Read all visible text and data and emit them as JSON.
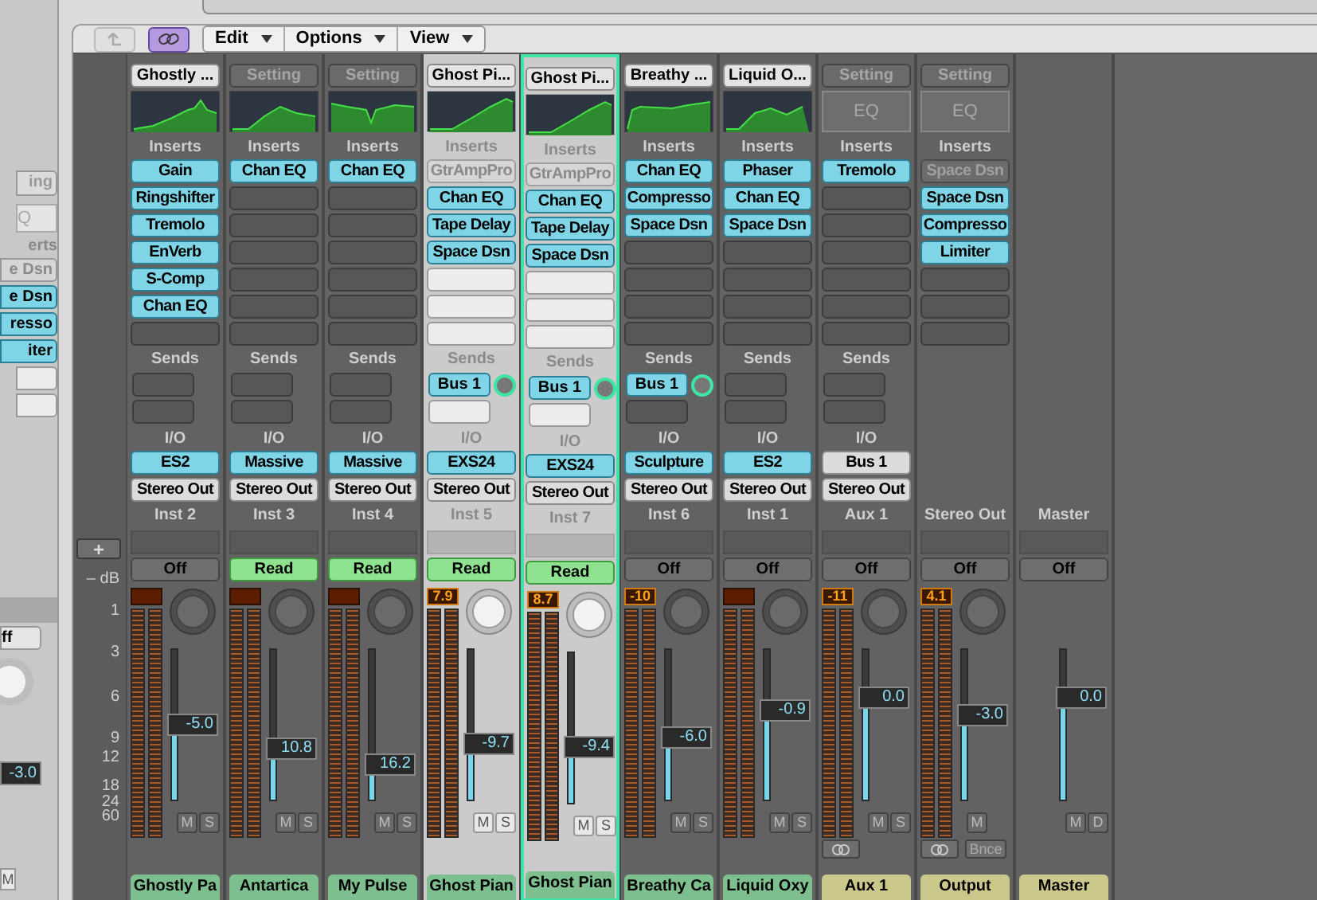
{
  "side_panel": {
    "upper": [
      {
        "kind": "button",
        "text": "ing"
      },
      {
        "kind": "field",
        "text": "Q"
      },
      {
        "kind": "label",
        "text": "erts"
      },
      {
        "kind": "slot",
        "text": "e Dsn",
        "bypassed": true
      },
      {
        "kind": "slot",
        "text": "e Dsn",
        "bypassed": false
      },
      {
        "kind": "slot",
        "text": "resso",
        "bypassed": false
      },
      {
        "kind": "slot",
        "text": "iter",
        "bypassed": false
      },
      {
        "kind": "empty"
      },
      {
        "kind": "empty"
      }
    ],
    "automation": "ff",
    "fader_value": "-3.0",
    "mute": "M"
  },
  "toolbar": {
    "back": {
      "disabled": true
    },
    "link": {
      "on": true
    },
    "menus": [
      "Edit",
      "Options",
      "View"
    ]
  },
  "scale": {
    "add": "+",
    "marks": [
      "– dB",
      "1",
      "3",
      "6",
      "9",
      "12",
      "18",
      "24",
      "60"
    ]
  },
  "strips": [
    {
      "kind": "track",
      "selected": false,
      "highlighted": false,
      "setting": {
        "text": "Ghostly ...",
        "dim": false
      },
      "eq": {
        "kind": "curve"
      },
      "inserts_label": "Inserts",
      "inserts": [
        {
          "text": "Gain",
          "bypassed": false
        },
        {
          "text": "Ringshifter",
          "bypassed": false
        },
        {
          "text": "Tremolo",
          "bypassed": false
        },
        {
          "text": "EnVerb",
          "bypassed": false
        },
        {
          "text": "S-Comp",
          "bypassed": false
        },
        {
          "text": "Chan EQ",
          "bypassed": false
        }
      ],
      "sends_label": "Sends",
      "io_label": "I/O",
      "input": {
        "text": "ES2",
        "active": true
      },
      "output": {
        "text": "Stereo Out",
        "active": false
      },
      "channel": "Inst 2",
      "automation": {
        "text": "Off",
        "read": false
      },
      "level": 0.5,
      "fader_value": "-5.0",
      "buttons": [
        "M",
        "S"
      ],
      "name": "Ghostly Pa",
      "color": "#7dbf8e"
    },
    {
      "kind": "track",
      "selected": false,
      "highlighted": false,
      "setting": {
        "text": "Setting",
        "dim": true
      },
      "eq": {
        "kind": "curve"
      },
      "inserts_label": "Inserts",
      "inserts": [
        {
          "text": "Chan EQ",
          "bypassed": false
        }
      ],
      "sends_label": "Sends",
      "io_label": "I/O",
      "input": {
        "text": "Massive",
        "active": true
      },
      "output": {
        "text": "Stereo Out",
        "active": false
      },
      "channel": "Inst 3",
      "automation": {
        "text": "Read",
        "read": true
      },
      "level": 0.34,
      "fader_value": "10.8",
      "buttons": [
        "M",
        "S"
      ],
      "name": "Antartica",
      "color": "#7dbf8e"
    },
    {
      "kind": "track",
      "selected": false,
      "highlighted": false,
      "setting": {
        "text": "Setting",
        "dim": true
      },
      "eq": {
        "kind": "curve"
      },
      "inserts_label": "Inserts",
      "inserts": [
        {
          "text": "Chan EQ",
          "bypassed": false
        }
      ],
      "sends_label": "Sends",
      "io_label": "I/O",
      "input": {
        "text": "Massive",
        "active": true
      },
      "output": {
        "text": "Stereo Out",
        "active": false
      },
      "channel": "Inst 4",
      "automation": {
        "text": "Read",
        "read": true
      },
      "level": 0.23,
      "fader_value": "16.2",
      "buttons": [
        "M",
        "S"
      ],
      "name": "My Pulse",
      "color": "#7dbf8e"
    },
    {
      "kind": "track",
      "selected": false,
      "highlighted": true,
      "setting": {
        "text": "Ghost Pi...",
        "dim": false
      },
      "eq": {
        "kind": "curve"
      },
      "inserts_label": "Inserts",
      "inserts": [
        {
          "text": "GtrAmpPro",
          "bypassed": true
        },
        {
          "text": "Chan EQ",
          "bypassed": false
        },
        {
          "text": "Tape Delay",
          "bypassed": false
        },
        {
          "text": "Space Dsn",
          "bypassed": false
        }
      ],
      "sends_label": "Sends",
      "sends": [
        {
          "text": "Bus 1"
        }
      ],
      "io_label": "I/O",
      "input": {
        "text": "EXS24",
        "active": true
      },
      "output": {
        "text": "Stereo Out",
        "active": false
      },
      "channel": "Inst 5",
      "automation": {
        "text": "Read",
        "read": true
      },
      "peak": "7.9",
      "level": 0.37,
      "fader_value": "-9.7",
      "buttons": [
        "M",
        "S"
      ],
      "name": "Ghost Pian",
      "color": "#7dbf8e"
    },
    {
      "kind": "track",
      "selected": true,
      "highlighted": true,
      "setting": {
        "text": "Ghost Pi...",
        "dim": false
      },
      "eq": {
        "kind": "curve"
      },
      "inserts_label": "Inserts",
      "inserts": [
        {
          "text": "GtrAmpPro",
          "bypassed": true
        },
        {
          "text": "Chan EQ",
          "bypassed": false
        },
        {
          "text": "Tape Delay",
          "bypassed": false
        },
        {
          "text": "Space Dsn",
          "bypassed": false
        }
      ],
      "sends_label": "Sends",
      "sends": [
        {
          "text": "Bus 1"
        }
      ],
      "io_label": "I/O",
      "input": {
        "text": "EXS24",
        "active": true
      },
      "output": {
        "text": "Stereo Out",
        "active": false
      },
      "channel": "Inst 7",
      "automation": {
        "text": "Read",
        "read": true
      },
      "peak": "8.7",
      "level": 0.37,
      "fader_value": "-9.4",
      "buttons": [
        "M",
        "S"
      ],
      "name": "Ghost Pian",
      "color": "#7dbf8e"
    },
    {
      "kind": "track",
      "selected": false,
      "highlighted": false,
      "setting": {
        "text": "Breathy ...",
        "dim": false
      },
      "eq": {
        "kind": "curve"
      },
      "inserts_label": "Inserts",
      "inserts": [
        {
          "text": "Chan EQ",
          "bypassed": false
        },
        {
          "text": "Compresso",
          "bypassed": false
        },
        {
          "text": "Space Dsn",
          "bypassed": false
        }
      ],
      "sends_label": "Sends",
      "sends": [
        {
          "text": "Bus 1"
        }
      ],
      "io_label": "I/O",
      "input": {
        "text": "Sculpture",
        "active": true
      },
      "output": {
        "text": "Stereo Out",
        "active": false
      },
      "channel": "Inst 6",
      "automation": {
        "text": "Off",
        "read": false
      },
      "peak": "-10",
      "level": 0.42,
      "fader_value": "-6.0",
      "buttons": [
        "M",
        "S"
      ],
      "name": "Breathy Ca",
      "color": "#7dbf8e"
    },
    {
      "kind": "track",
      "selected": false,
      "highlighted": false,
      "setting": {
        "text": "Liquid O...",
        "dim": false
      },
      "eq": {
        "kind": "curve"
      },
      "inserts_label": "Inserts",
      "inserts": [
        {
          "text": "Phaser",
          "bypassed": false
        },
        {
          "text": "Chan EQ",
          "bypassed": false
        },
        {
          "text": "Space Dsn",
          "bypassed": false
        }
      ],
      "sends_label": "Sends",
      "io_label": "I/O",
      "input": {
        "text": "ES2",
        "active": true
      },
      "output": {
        "text": "Stereo Out",
        "active": false
      },
      "channel": "Inst 1",
      "automation": {
        "text": "Off",
        "read": false
      },
      "level": 0.6,
      "fader_value": "-0.9",
      "buttons": [
        "M",
        "S"
      ],
      "name": "Liquid Oxy",
      "color": "#7dbf8e"
    },
    {
      "kind": "track",
      "selected": false,
      "highlighted": false,
      "setting": {
        "text": "Setting",
        "dim": true
      },
      "eq": {
        "kind": "label",
        "text": "EQ"
      },
      "inserts_label": "Inserts",
      "inserts": [
        {
          "text": "Tremolo",
          "bypassed": false
        }
      ],
      "sends_label": "Sends",
      "io_label": "I/O",
      "input": {
        "text": "Bus 1",
        "active": false
      },
      "output": {
        "text": "Stereo Out",
        "active": false
      },
      "channel": "Aux 1",
      "automation": {
        "text": "Off",
        "read": false
      },
      "peak": "-11",
      "level": 0.68,
      "fader_value": "0.0",
      "buttons": [
        "M",
        "S"
      ],
      "link": true,
      "name": "Aux 1",
      "color": "#cbc88c"
    },
    {
      "kind": "output",
      "selected": false,
      "highlighted": false,
      "setting": {
        "text": "Setting",
        "dim": true
      },
      "eq": {
        "kind": "label",
        "text": "EQ"
      },
      "inserts_label": "Inserts",
      "inserts": [
        {
          "text": "Space Dsn",
          "bypassed": true
        },
        {
          "text": "Space Dsn",
          "bypassed": false
        },
        {
          "text": "Compresso",
          "bypassed": false
        },
        {
          "text": "Limiter",
          "bypassed": false
        }
      ],
      "channel": "Stereo Out",
      "automation": {
        "text": "Off",
        "read": false
      },
      "peak": "4.1",
      "level": 0.56,
      "fader_value": "-3.0",
      "buttons": [
        "M"
      ],
      "link": true,
      "extra": "Bnce",
      "name": "Output",
      "color": "#cbc88c"
    },
    {
      "kind": "master",
      "selected": false,
      "highlighted": false,
      "channel": "Master",
      "automation": {
        "text": "Off",
        "read": false
      },
      "level": 0.68,
      "fader_value": "0.0",
      "buttons": [
        "M",
        "D"
      ],
      "name": "Master",
      "color": "#cbc88c"
    }
  ]
}
